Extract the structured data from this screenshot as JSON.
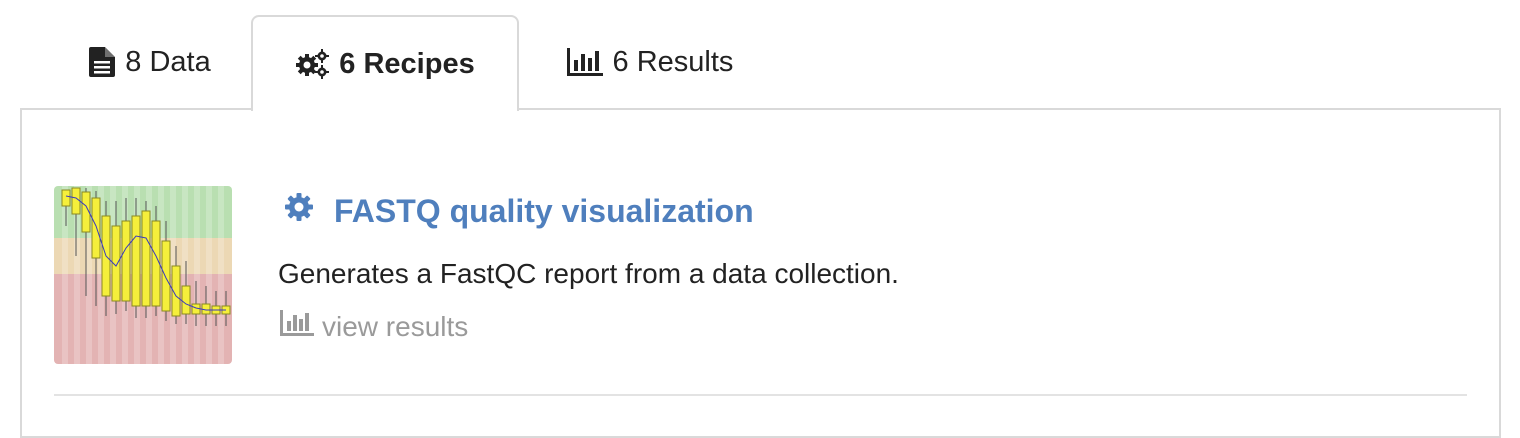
{
  "tabs": [
    {
      "label": "8 Data",
      "icon": "file-text-icon",
      "active": false
    },
    {
      "label": "6 Recipes",
      "icon": "gears-icon",
      "active": true
    },
    {
      "label": "6 Results",
      "icon": "bar-chart-icon",
      "active": false
    }
  ],
  "recipe": {
    "title": "FASTQ quality visualization",
    "icon": "gear-icon",
    "description": "Generates a FastQC report from a data collection.",
    "view_results_label": "view results",
    "view_results_icon": "bar-chart-icon"
  },
  "colors": {
    "link": "#4f7fbd",
    "muted": "#9a9a9a",
    "border": "#d9d9d9",
    "thumb_green": "#b9dfb1",
    "thumb_orange": "#ecd8b4",
    "thumb_red": "#e3b3b3",
    "box_yellow": "#f5ef3b"
  }
}
